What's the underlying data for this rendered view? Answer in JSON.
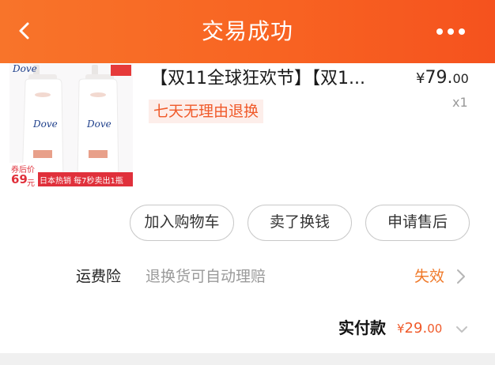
{
  "header": {
    "title": "交易成功",
    "back_icon": "chevron-left-icon",
    "more_icon": "more-dots-icon",
    "gradient": [
      "#f8742a",
      "#f5521e"
    ]
  },
  "product": {
    "title": "【双11全球狂欢节】【双1...",
    "price_symbol": "¥",
    "price_int": "79.",
    "price_dec": "00",
    "quantity": "x1",
    "return_policy": "七天无理由退换",
    "image": {
      "brand": "Dove",
      "promo_line1": "券后价",
      "promo_price": "69",
      "promo_unit": "元",
      "banner": "日本热销 每7秒卖出1瓶"
    }
  },
  "actions": {
    "add_to_cart": "加入购物车",
    "resell": "卖了换钱",
    "after_sales": "申请售后"
  },
  "shipping_insurance": {
    "label": "运费险",
    "description": "退换货可自动理赔",
    "status": "失效"
  },
  "payment": {
    "label": "实付款",
    "symbol": "¥",
    "amount_int": "29.",
    "amount_dec": "00"
  },
  "colors": {
    "accent": "#f05a2a",
    "status": "#f07a2a",
    "tag_bg": "#fdeeea"
  }
}
